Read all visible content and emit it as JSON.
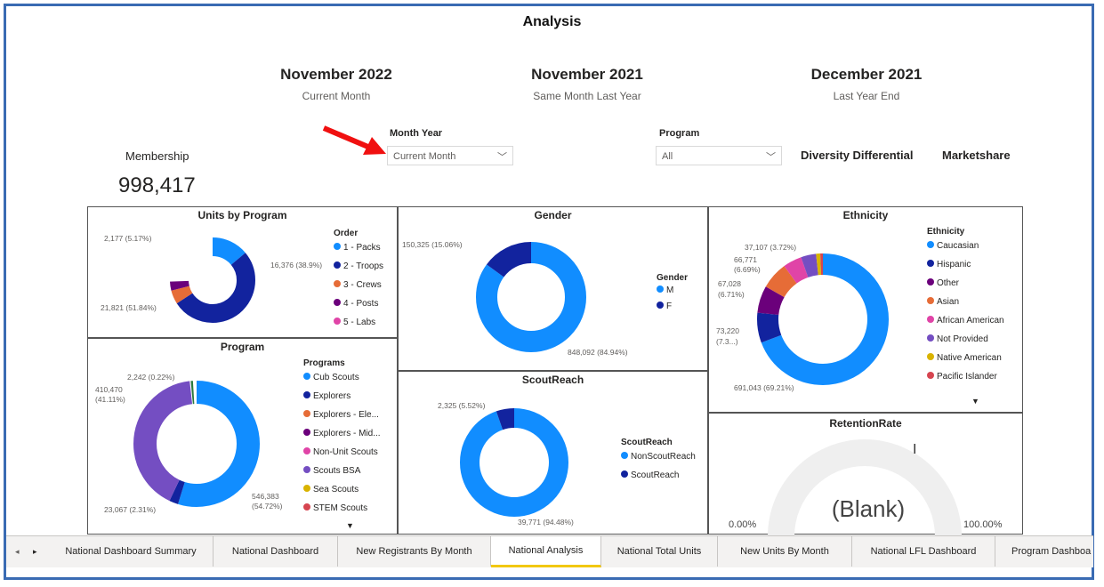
{
  "title": "Analysis",
  "periods": [
    {
      "label": "November 2022",
      "sub": "Current Month"
    },
    {
      "label": "November 2021",
      "sub": "Same Month Last Year"
    },
    {
      "label": "December 2021",
      "sub": "Last Year End"
    }
  ],
  "slicers": {
    "month_year": {
      "label": "Month Year",
      "value": "Current Month"
    },
    "program": {
      "label": "Program",
      "value": "All"
    }
  },
  "kpis": {
    "membership_label": "Membership",
    "membership_value": "998,417",
    "diversity_label": "Diversity Differential",
    "marketshare_label": "Marketshare"
  },
  "units_by_program": {
    "title": "Units by Program",
    "legend_title": "Order",
    "legend": [
      "1 - Packs",
      "2 - Troops",
      "3 - Crews",
      "4 - Posts",
      "5 - Labs"
    ],
    "colors": [
      "#118dff",
      "#12239e",
      "#e66c37",
      "#6b007b",
      "#e044a7"
    ],
    "labels": [
      "2,177 (5.17%)",
      "16,376 (38.9%)",
      "21,821 (51.84%)"
    ]
  },
  "gender": {
    "title": "Gender",
    "legend_title": "Gender",
    "legend": [
      "M",
      "F"
    ],
    "colors": [
      "#118dff",
      "#12239e"
    ],
    "labels": [
      "150,325 (15.06%)",
      "848,092 (84.94%)"
    ]
  },
  "ethnicity": {
    "title": "Ethnicity",
    "legend_title": "Ethnicity",
    "legend": [
      "Caucasian",
      "Hispanic",
      "Other",
      "Asian",
      "African American",
      "Not Provided",
      "Native American",
      "Pacific Islander"
    ],
    "colors": [
      "#118dff",
      "#12239e",
      "#6b007b",
      "#e66c37",
      "#e044a7",
      "#744ec2",
      "#d9b300",
      "#d64550"
    ],
    "labels": [
      "37,107 (3.72%)",
      "66,771",
      "(6.69%)",
      "67,028",
      "(6.71%)",
      "73,220",
      "(7.3...)",
      "691,043 (69.21%)"
    ],
    "more": "▼"
  },
  "program": {
    "title": "Program",
    "legend_title": "Programs",
    "legend": [
      "Cub Scouts",
      "Explorers",
      "Explorers - Ele...",
      "Explorers - Mid...",
      "Non-Unit Scouts",
      "Scouts BSA",
      "Sea Scouts",
      "STEM Scouts"
    ],
    "colors": [
      "#118dff",
      "#12239e",
      "#e66c37",
      "#6b007b",
      "#e044a7",
      "#744ec2",
      "#d9b300",
      "#d64550"
    ],
    "labels": [
      "2,242 (0.22%)",
      "410,470",
      "(41.11%)",
      "23,067 (2.31%)",
      "546,383",
      "(54.72%)"
    ],
    "more": "▼"
  },
  "scoutreach": {
    "title": "ScoutReach",
    "legend_title": "ScoutReach",
    "legend": [
      "NonScoutReach",
      "ScoutReach"
    ],
    "colors": [
      "#118dff",
      "#12239e"
    ],
    "labels": [
      "2,325 (5.52%)",
      "39,771 (94.48%)"
    ]
  },
  "retention": {
    "title": "RetentionRate",
    "min": "0.00%",
    "max": "100.00%",
    "value": "(Blank)"
  },
  "tabs": [
    "National Dashboard Summary",
    "National Dashboard",
    "New Registrants By Month",
    "National Analysis",
    "National Total Units",
    "New Units By Month",
    "National LFL Dashboard",
    "Program Dashboa"
  ],
  "active_tab": "National Analysis",
  "nav": {
    "prev": "◂",
    "next": "▸"
  },
  "accent": "#f2c811",
  "arrow_color": "#f01010"
}
